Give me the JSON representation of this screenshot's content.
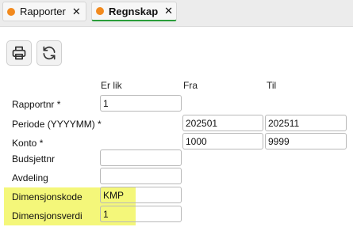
{
  "tabs": [
    {
      "label": "Rapporter",
      "close": "✕"
    },
    {
      "label": "Regnskap",
      "close": "✕"
    }
  ],
  "toolbar": {
    "print_icon": "printer-icon",
    "refresh_icon": "refresh-icon"
  },
  "columns": {
    "er_lik": "Er lik",
    "fra": "Fra",
    "til": "Til"
  },
  "rows": {
    "rapportnr": {
      "label": "Rapportnr *",
      "er_lik": "1"
    },
    "periode": {
      "label": "Periode (YYYYMM) *",
      "fra": "202501",
      "til": "202511"
    },
    "konto": {
      "label": "Konto *",
      "fra": "1000",
      "til": "9999"
    },
    "budsjettnr": {
      "label": "Budsjettnr",
      "er_lik": ""
    },
    "avdeling": {
      "label": "Avdeling",
      "er_lik": ""
    },
    "dimensjonskode": {
      "label": "Dimensjonskode",
      "er_lik": "KMP"
    },
    "dimensjonsverdi": {
      "label": "Dimensjonsverdi",
      "er_lik": "1"
    }
  },
  "colors": {
    "tab_dot": "#f28a1e",
    "active_tab_underline": "#2a9d3a",
    "highlight": "#f4f77a"
  }
}
